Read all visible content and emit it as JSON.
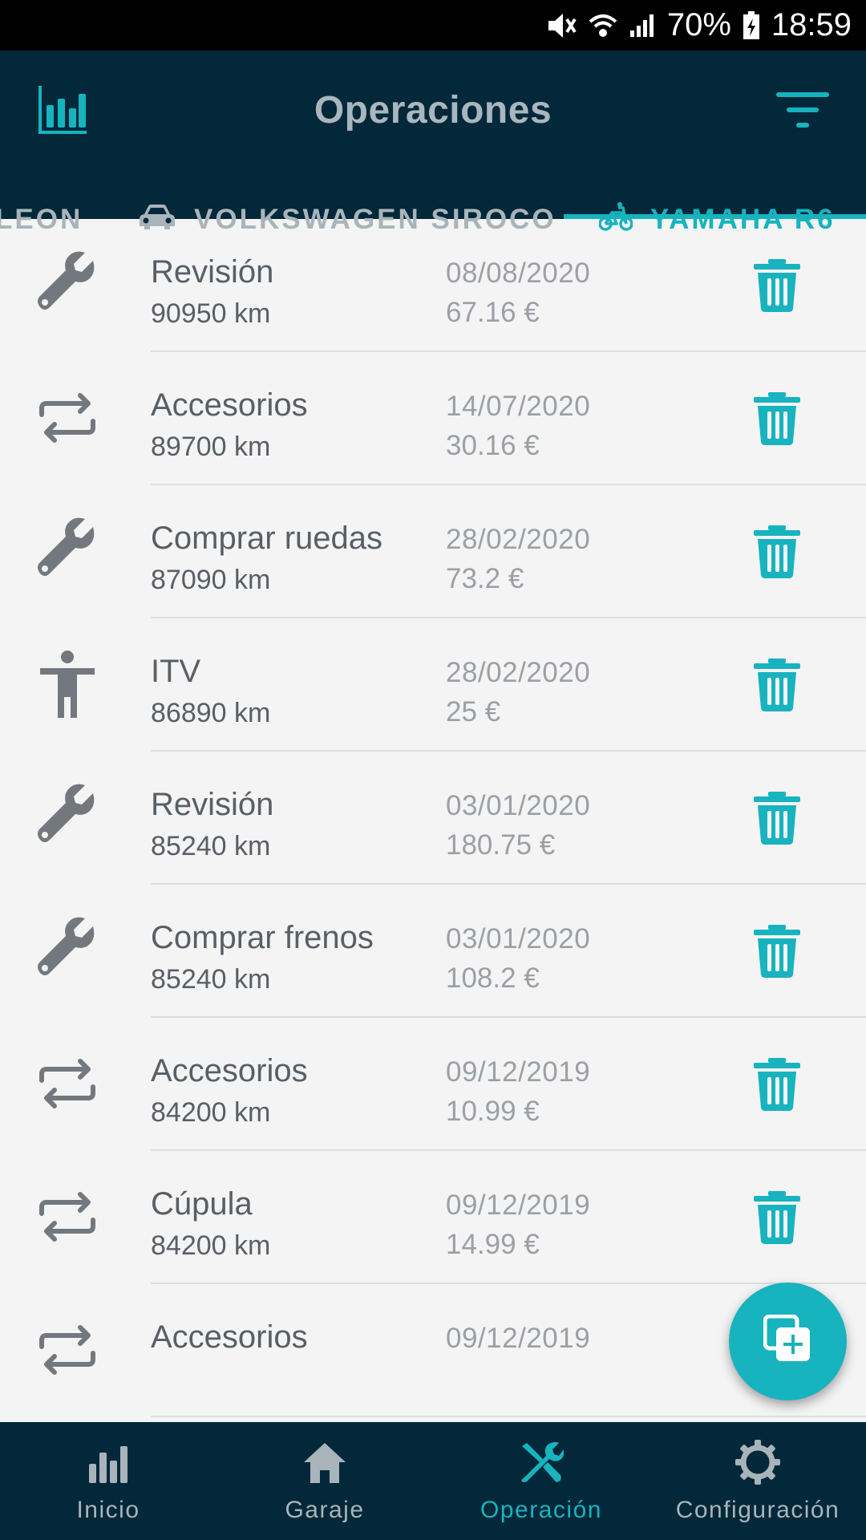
{
  "status_bar": {
    "battery": "70%",
    "time": "18:59"
  },
  "header": {
    "title": "Operaciones",
    "stats_icon": "bar-chart-icon",
    "filter_icon": "filter-icon"
  },
  "tabs": [
    {
      "label": "LEON",
      "icon": "car-icon"
    },
    {
      "label": "VOLKSWAGEN SIROCO",
      "icon": "car-icon"
    },
    {
      "label": "YAMAHA R6",
      "icon": "bike-icon",
      "active": true
    }
  ],
  "operations": [
    {
      "name": "Revisión",
      "km": "90950 km",
      "date": "08/08/2020",
      "cost": "67.16 €",
      "icon": "wrench-icon"
    },
    {
      "name": "Accesorios",
      "km": "89700 km",
      "date": "14/07/2020",
      "cost": "30.16 €",
      "icon": "swap-icon"
    },
    {
      "name": "Comprar ruedas",
      "km": "87090 km",
      "date": "28/02/2020",
      "cost": "73.2 €",
      "icon": "wrench-icon"
    },
    {
      "name": "ITV",
      "km": "86890 km",
      "date": "28/02/2020",
      "cost": "25 €",
      "icon": "person-icon"
    },
    {
      "name": "Revisión",
      "km": "85240 km",
      "date": "03/01/2020",
      "cost": "180.75 €",
      "icon": "wrench-icon"
    },
    {
      "name": "Comprar frenos",
      "km": "85240 km",
      "date": "03/01/2020",
      "cost": "108.2 €",
      "icon": "wrench-icon"
    },
    {
      "name": "Accesorios",
      "km": "84200 km",
      "date": "09/12/2019",
      "cost": "10.99 €",
      "icon": "swap-icon"
    },
    {
      "name": "Cúpula",
      "km": "84200 km",
      "date": "09/12/2019",
      "cost": "14.99 €",
      "icon": "swap-icon"
    },
    {
      "name": "Accesorios",
      "km": "",
      "date": "09/12/2019",
      "cost": "",
      "icon": "swap-icon"
    }
  ],
  "bottom_nav": [
    {
      "label": "Inicio",
      "icon": "bar-chart-icon"
    },
    {
      "label": "Garaje",
      "icon": "home-icon"
    },
    {
      "label": "Operación",
      "icon": "tools-icon",
      "active": true
    },
    {
      "label": "Configuración",
      "icon": "gear-icon"
    }
  ],
  "colors": {
    "primary_dark": "#02283a",
    "accent": "#17b3bf",
    "text": "#585f66",
    "muted": "#9aa0a6",
    "background": "#f4f4f4"
  }
}
